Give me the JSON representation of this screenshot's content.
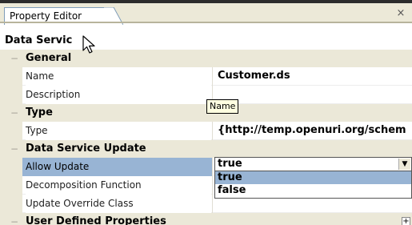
{
  "tab": {
    "label": "Property Editor",
    "close_glyph": "×"
  },
  "title": "Data Servic",
  "categories": {
    "general": "General",
    "type": "Type",
    "update": "Data Service Update",
    "user_defined": "User Defined Properties"
  },
  "props": {
    "name": {
      "label": "Name",
      "value": "Customer.ds"
    },
    "description": {
      "label": "Description",
      "value": ""
    },
    "type": {
      "label": "Type",
      "value": "{http://temp.openuri.org/schem"
    },
    "allow_update": {
      "label": "Allow Update",
      "value": "true"
    },
    "decomposition": {
      "label": "Decomposition Function",
      "value": ""
    },
    "override": {
      "label": "Update Override Class",
      "value": ""
    }
  },
  "tooltip": "Name",
  "dropdown": {
    "selected": "true",
    "options": [
      "true",
      "false"
    ]
  },
  "glyphs": {
    "collapse": "−",
    "expand": "+",
    "dropdown_arrow": "▼"
  },
  "colors": {
    "category_bg": "#ebe8d8",
    "selection": "#98b4d4",
    "tooltip_bg": "#ffffe1"
  }
}
